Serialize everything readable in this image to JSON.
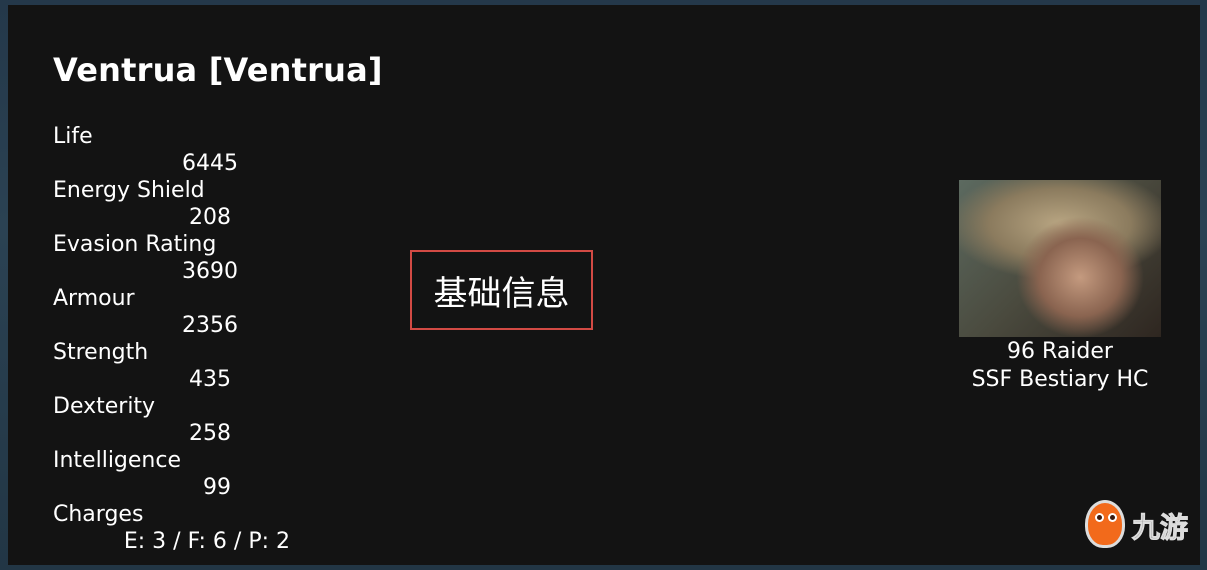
{
  "character": {
    "title": "Ventrua [Ventrua]",
    "level_class": "96 Raider",
    "league": "SSF Bestiary HC"
  },
  "stats": [
    {
      "label": "Life",
      "value": "6445"
    },
    {
      "label": "Energy Shield",
      "value": "208"
    },
    {
      "label": "Evasion Rating",
      "value": "3690"
    },
    {
      "label": "Armour",
      "value": "2356"
    },
    {
      "label": "Strength",
      "value": "435"
    },
    {
      "label": "Dexterity",
      "value": "258"
    },
    {
      "label": "Intelligence",
      "value": "99"
    },
    {
      "label": "Charges",
      "value": "E: 3 / F: 6 / P: 2"
    }
  ],
  "annotation": {
    "label": "基础信息",
    "border_color": "#d24a44"
  },
  "watermark": {
    "text": "九游",
    "accent": "#f26a1b"
  }
}
